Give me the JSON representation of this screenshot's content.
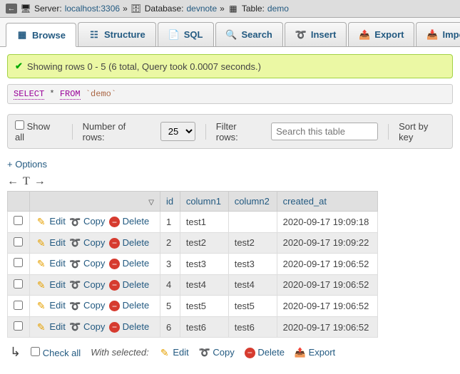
{
  "breadcrumb": {
    "server_label": "Server:",
    "server_value": "localhost:3306",
    "db_label": "Database:",
    "db_value": "devnote",
    "table_label": "Table:",
    "table_value": "demo",
    "sep": "»"
  },
  "tabs": {
    "browse": "Browse",
    "structure": "Structure",
    "sql": "SQL",
    "search": "Search",
    "insert": "Insert",
    "export": "Export",
    "import": "Import"
  },
  "success": {
    "text": "Showing rows 0 - 5 (6 total, Query took 0.0007 seconds.)"
  },
  "sql": {
    "select": "SELECT",
    "star": "*",
    "from": "FROM",
    "table": "`demo`"
  },
  "toolbar": {
    "show_all": "Show all",
    "num_rows_label": "Number of rows:",
    "num_rows_value": "25",
    "filter_label": "Filter rows:",
    "filter_placeholder": "Search this table",
    "sort_label": "Sort by key"
  },
  "options_link": "+ Options",
  "columns": [
    "id",
    "column1",
    "column2",
    "created_at"
  ],
  "actions": {
    "edit": "Edit",
    "copy": "Copy",
    "delete": "Delete"
  },
  "rows": [
    {
      "id": "1",
      "c1": "test1",
      "c2": "",
      "ts": "2020-09-17 19:09:18"
    },
    {
      "id": "2",
      "c1": "test2",
      "c2": "test2",
      "ts": "2020-09-17 19:09:22"
    },
    {
      "id": "3",
      "c1": "test3",
      "c2": "test3",
      "ts": "2020-09-17 19:06:52"
    },
    {
      "id": "4",
      "c1": "test4",
      "c2": "test4",
      "ts": "2020-09-17 19:06:52"
    },
    {
      "id": "5",
      "c1": "test5",
      "c2": "test5",
      "ts": "2020-09-17 19:06:52"
    },
    {
      "id": "6",
      "c1": "test6",
      "c2": "test6",
      "ts": "2020-09-17 19:06:52"
    }
  ],
  "bottom": {
    "check_all": "Check all",
    "with_selected": "With selected:",
    "edit": "Edit",
    "copy": "Copy",
    "delete": "Delete",
    "export": "Export"
  }
}
